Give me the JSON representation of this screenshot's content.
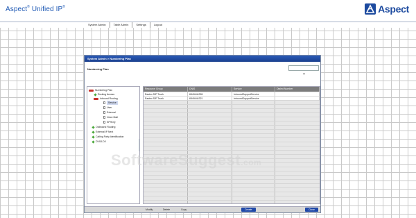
{
  "app": {
    "title_main": "Aspect",
    "title_reg": "®",
    "title_product": "Unified IP",
    "title_reg2": "®",
    "logo_text": "Aspect",
    "brand_color": "#1c4a9f"
  },
  "menu": {
    "items": [
      "System Admin",
      "Table Admin",
      "Settings",
      "Logout"
    ]
  },
  "dialog": {
    "breadcrumb": "System Admin > Numbering Plan",
    "subtitle": "Numbering Plan",
    "search_value": ""
  },
  "tree": {
    "items": [
      {
        "label": "Numbering Plan",
        "icon": "folder-icon"
      },
      {
        "label": "Routing Access",
        "icon": "diamond-icon"
      },
      {
        "label": "Inbound Routing",
        "icon": "folder-icon"
      },
      {
        "label": "Service",
        "icon": "page-icon"
      },
      {
        "label": "User",
        "icon": "page-icon"
      },
      {
        "label": "External",
        "icon": "page-icon"
      },
      {
        "label": "Voice Mail",
        "icon": "page-icon"
      },
      {
        "label": "SPHDQ",
        "icon": "page-icon"
      },
      {
        "label": "Outbound Routing",
        "icon": "diamond-icon"
      },
      {
        "label": "External IP Next",
        "icon": "diamond-icon"
      },
      {
        "label": "Calling Party Identification",
        "icon": "diamond-icon"
      },
      {
        "label": "DVS/LDX",
        "icon": "diamond-icon"
      }
    ]
  },
  "grid": {
    "columns": [
      "Resource Group",
      "DNIS",
      "Service",
      "Dialed Number"
    ],
    "rows": [
      [
        "Eastex SIP Trunk",
        "6549444326",
        "InboundSupportService",
        ""
      ],
      [
        "Eastex SIP Trunk",
        "6549444321",
        "InboundSupportService",
        ""
      ]
    ]
  },
  "footer": {
    "modify": "Modify",
    "delete": "Delete",
    "copy": "Copy",
    "create": "Create",
    "close": "Close"
  },
  "watermark": {
    "text": "SoftwareSuggest",
    "suffix": ".com"
  }
}
